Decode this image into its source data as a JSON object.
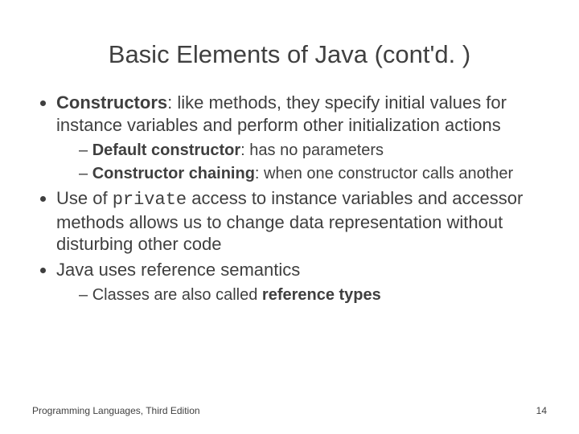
{
  "title": "Basic Elements of Java (cont'd. )",
  "b1": {
    "lead": "Constructors",
    "rest": ": like methods, they specify initial values for instance variables and perform other initialization actions",
    "sub1": {
      "lead": "Default constructor",
      "rest": ": has no parameters"
    },
    "sub2": {
      "lead": "Constructor chaining",
      "rest": ": when one constructor calls another"
    }
  },
  "b2": {
    "pre": "Use of ",
    "code": "private",
    "post": " access to instance variables and accessor methods allows us to change data representation without disturbing other code"
  },
  "b3": {
    "text": "Java uses reference semantics",
    "sub1": {
      "pre": "Classes are also called ",
      "bold": "reference types"
    }
  },
  "footer": {
    "left": "Programming Languages, Third Edition",
    "page": "14"
  }
}
